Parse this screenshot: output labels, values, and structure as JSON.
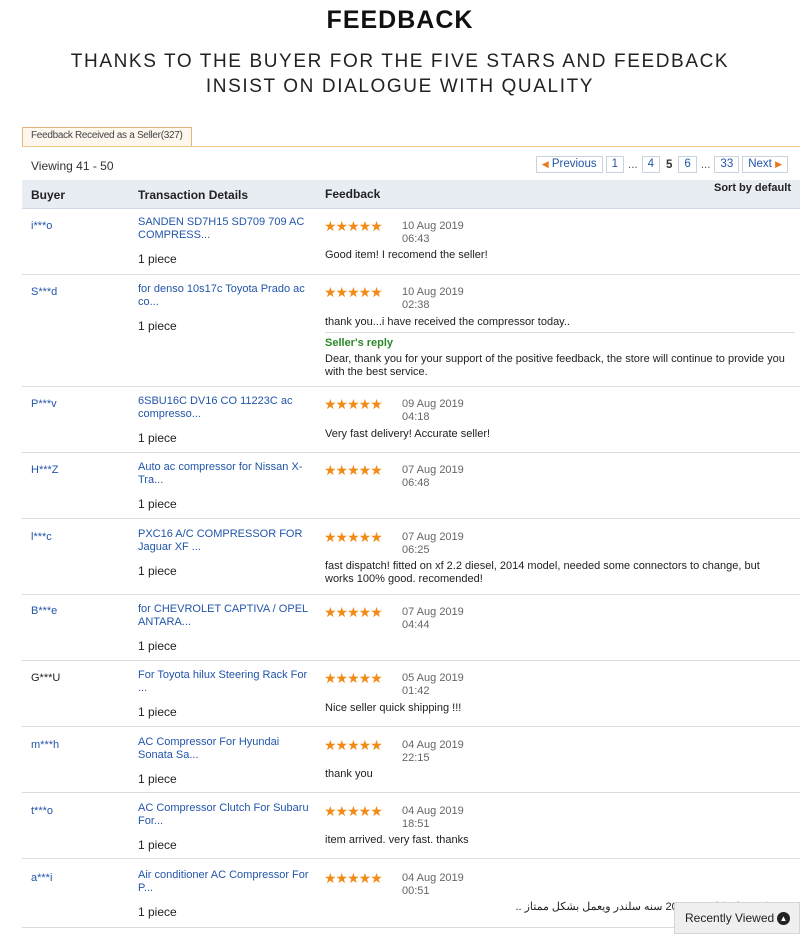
{
  "banner": {
    "title": "FEEDBACK",
    "line1": "THANKS TO THE BUYER FOR THE FIVE STARS AND FEEDBACK",
    "line2": "INSIST ON DIALOGUE WITH QUALITY"
  },
  "tab": {
    "label": "Feedback Received as a Seller(327)"
  },
  "viewing": "Viewing 41 - 50",
  "pagination": {
    "prev": "Previous",
    "pages": [
      "1",
      "...",
      "4",
      "5",
      "6",
      "...",
      "33"
    ],
    "current": "5",
    "next": "Next"
  },
  "table": {
    "headers": {
      "buyer": "Buyer",
      "transaction": "Transaction Details",
      "feedback": "Feedback",
      "sort": "Sort by default"
    },
    "stars": "★★★★★",
    "rows": [
      {
        "buyer": "i***o",
        "item": "SANDEN SD7H15 SD709 709 AC COMPRESS...",
        "qty": "1 piece",
        "date": "10 Aug 2019",
        "time": "06:43",
        "feedback": "Good item! I recomend the seller!"
      },
      {
        "buyer": "S***d",
        "item": "for denso 10s17c Toyota Prado ac co...",
        "qty": "1 piece",
        "date": "10 Aug 2019",
        "time": "02:38",
        "feedback": "thank you...i have received the compressor today..",
        "reply_label": "Seller's reply",
        "reply": "Dear, thank you for your support of the positive feedback, the store will continue to provide you with the best service."
      },
      {
        "buyer": "P***v",
        "item": "6SBU16C DV16 CO 11223C ac compresso...",
        "qty": "1 piece",
        "date": "09 Aug 2019",
        "time": "04:18",
        "feedback": "Very fast delivery! Accurate seller!"
      },
      {
        "buyer": "H***Z",
        "item": "Auto ac compressor for Nissan X-Tra...",
        "qty": "1 piece",
        "date": "07 Aug 2019",
        "time": "06:48",
        "feedback": ""
      },
      {
        "buyer": "l***c",
        "item": "PXC16 A/C COMPRESSOR FOR Jaguar XF ...",
        "qty": "1 piece",
        "date": "07 Aug 2019",
        "time": "06:25",
        "feedback": "fast dispatch! fitted on xf 2.2 diesel, 2014 model, needed some connectors to change, but works 100% good. recomended!"
      },
      {
        "buyer": "B***e",
        "item": "for CHEVROLET CAPTIVA / OPEL ANTARA...",
        "qty": "1 piece",
        "date": "07 Aug 2019",
        "time": "04:44",
        "feedback": ""
      },
      {
        "buyer": "G***U",
        "item": "For Toyota hilux Steering Rack For ...",
        "qty": "1 piece",
        "date": "05 Aug 2019",
        "time": "01:42",
        "feedback": "Nice seller quick shipping !!!"
      },
      {
        "buyer": "m***h",
        "item": "AC Compressor For Hyundai Sonata Sa...",
        "qty": "1 piece",
        "date": "04 Aug 2019",
        "time": "22:15",
        "feedback": "thank you"
      },
      {
        "buyer": "t***o",
        "item": "AC Compressor Clutch For Subaru For...",
        "qty": "1 piece",
        "date": "04 Aug 2019",
        "time": "18:51",
        "feedback": "item arrived. very fast. thanks"
      },
      {
        "buyer": "a***i",
        "item": "Air conditioner AC Compressor For P...",
        "qty": "1 piece",
        "date": "04 Aug 2019",
        "time": "00:51",
        "feedback": "تم تركيبه على كابرس 2010 سنه سلندر ويعمل بشكل ممتاز .."
      }
    ]
  },
  "recently_viewed": {
    "label": "Recently Viewed"
  },
  "colors": {
    "link": "#2255aa",
    "stars": "#f28a16",
    "reply": "#2a8a2a",
    "header_bg": "#e8edf4"
  }
}
